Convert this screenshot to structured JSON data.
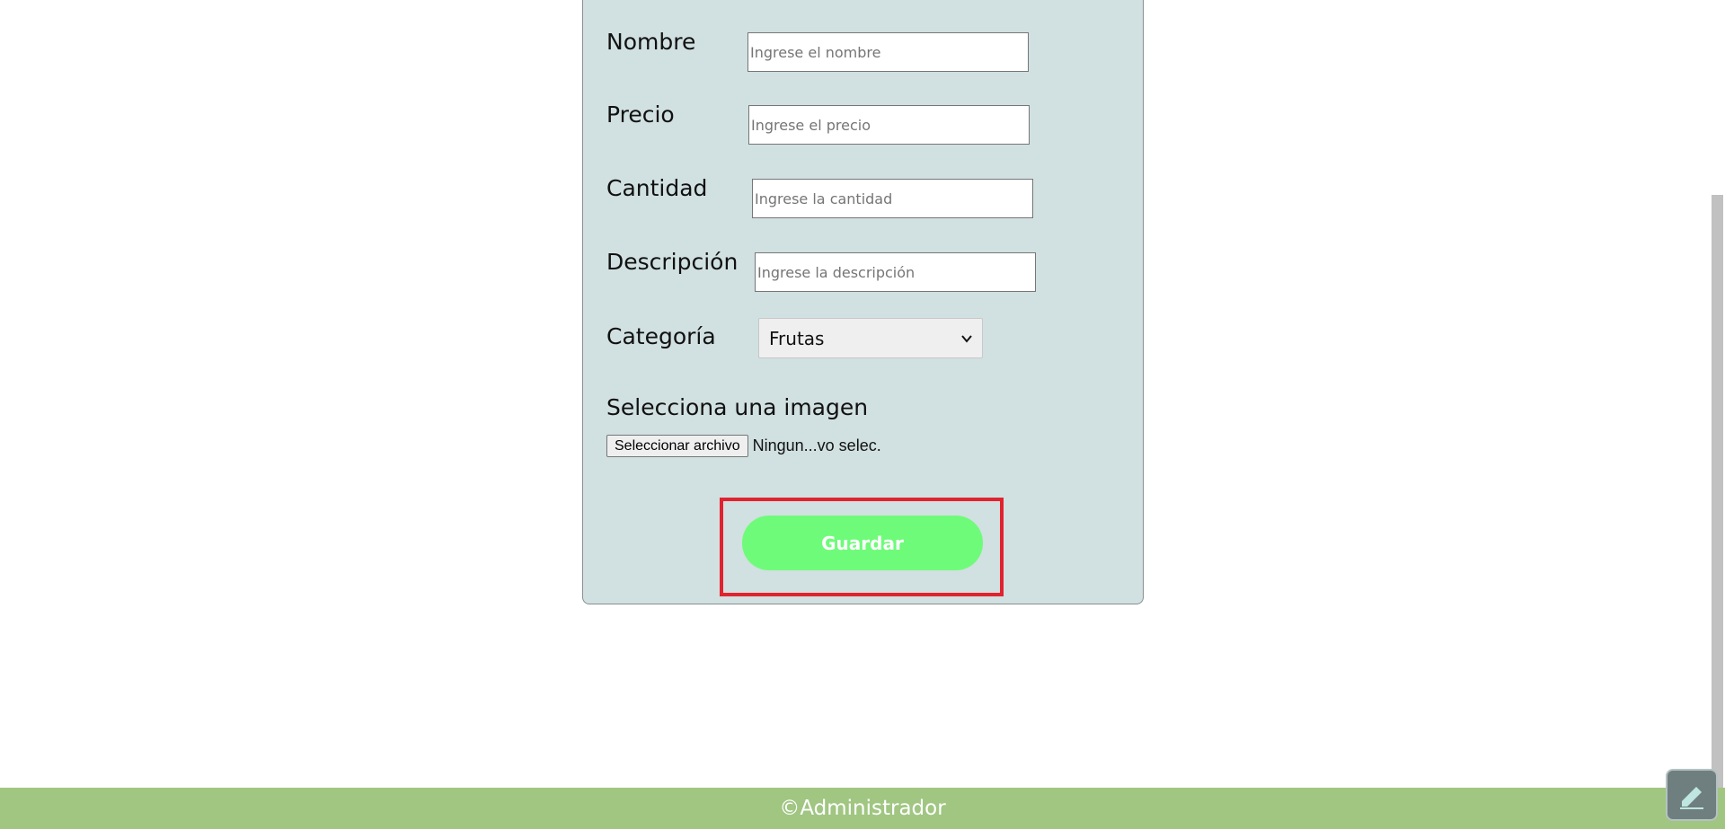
{
  "form": {
    "nombre": {
      "label": "Nombre",
      "placeholder": "Ingrese el nombre"
    },
    "precio": {
      "label": "Precio",
      "placeholder": "Ingrese el precio"
    },
    "cantidad": {
      "label": "Cantidad",
      "placeholder": "Ingrese la cantidad"
    },
    "descripcion": {
      "label": "Descripción",
      "placeholder": "Ingrese la descripción"
    },
    "categoria": {
      "label": "Categoría",
      "selected": "Frutas"
    },
    "imagen": {
      "label": "Selecciona una imagen",
      "button": "Seleccionar archivo",
      "status": "Ningun...vo selec."
    },
    "save_label": "Guardar"
  },
  "footer": {
    "text": "©Administrador"
  },
  "icons": {
    "select_arrow": "chevron-down-icon",
    "floating_action": "pencil-icon"
  },
  "colors": {
    "card_background": "#d1e0e0",
    "save_button": "#6ffb7a",
    "highlight": "#e0232e",
    "footer": "#a0c682"
  }
}
